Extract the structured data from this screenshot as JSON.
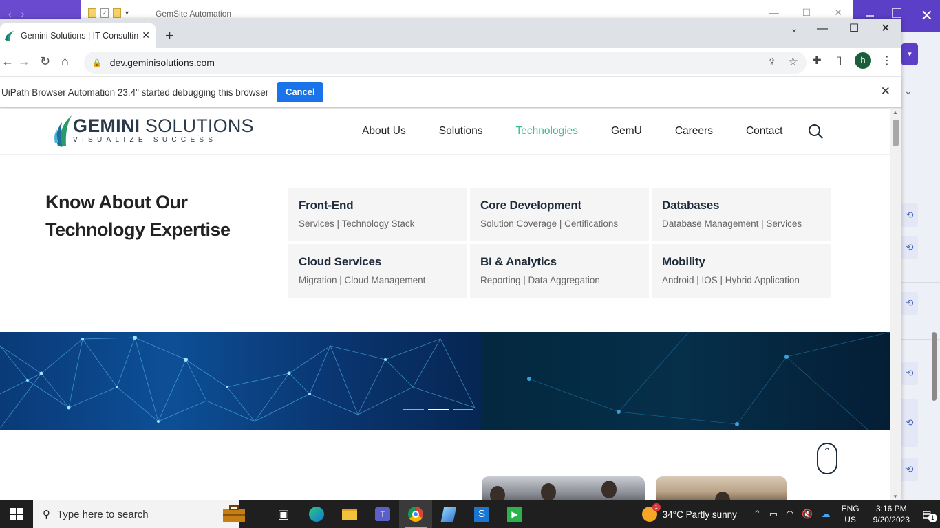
{
  "background_window": {
    "title": "GemSite Automation"
  },
  "browser": {
    "tab_title": "Gemini Solutions | IT Consulting",
    "url": "dev.geminisolutions.com",
    "profile_initial": "h",
    "infobar": {
      "message": "UiPath Browser Automation 23.4\" started debugging this browser",
      "cancel_label": "Cancel"
    }
  },
  "site": {
    "logo": {
      "name_bold": "GEMINI",
      "name_rest": " SOLUTIONS",
      "tagline": "VISUALIZE SUCCESS"
    },
    "nav": [
      {
        "label": "About Us",
        "active": false
      },
      {
        "label": "Solutions",
        "active": false
      },
      {
        "label": "Technologies",
        "active": true
      },
      {
        "label": "GemU",
        "active": false
      },
      {
        "label": "Careers",
        "active": false
      },
      {
        "label": "Contact",
        "active": false
      }
    ],
    "mega_menu": {
      "title_line1": "Know About Our",
      "title_line2": "Technology Expertise",
      "cards": [
        {
          "heading": "Front-End",
          "sub": "Services | Technology Stack"
        },
        {
          "heading": "Core Development",
          "sub": "Solution Coverage | Certifications"
        },
        {
          "heading": "Databases",
          "sub": "Database Management | Services"
        },
        {
          "heading": "Cloud Services",
          "sub": "Migration | Cloud Management"
        },
        {
          "heading": "BI & Analytics",
          "sub": "Reporting | Data Aggregation"
        },
        {
          "heading": "Mobility",
          "sub": "Android | IOS | Hybrid Application"
        }
      ]
    },
    "carousel": {
      "slides": 3,
      "active_index": 1
    }
  },
  "taskbar": {
    "search_placeholder": "Type here to search",
    "weather": "34°C  Partly sunny",
    "weather_badge": "1",
    "lang_line1": "ENG",
    "lang_line2": "US",
    "time": "3:16 PM",
    "date": "9/20/2023",
    "notification_count": "1"
  },
  "colors": {
    "accent_green": "#3bbf8f",
    "chrome_blue": "#1a73e8",
    "brand_dark": "#1d2b3a"
  }
}
